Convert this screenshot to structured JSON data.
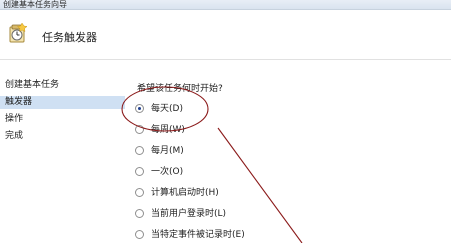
{
  "window": {
    "title": "创建基本任务向导"
  },
  "header": {
    "title": "任务触发器"
  },
  "sidebar": {
    "items": [
      {
        "label": "创建基本任务",
        "selected": false
      },
      {
        "label": "触发器",
        "selected": true
      },
      {
        "label": "操作",
        "selected": false
      },
      {
        "label": "完成",
        "selected": false
      }
    ]
  },
  "main": {
    "question": "希望该任务何时开始?",
    "options": [
      {
        "label": "每天(D)",
        "checked": true
      },
      {
        "label": "每周(W)",
        "checked": false
      },
      {
        "label": "每月(M)",
        "checked": false
      },
      {
        "label": "一次(O)",
        "checked": false
      },
      {
        "label": "计算机启动时(H)",
        "checked": false
      },
      {
        "label": "当前用户登录时(L)",
        "checked": false
      },
      {
        "label": "当特定事件被记录时(E)",
        "checked": false
      }
    ]
  },
  "annotation": {
    "color": "#8b1a1a"
  },
  "icons": {
    "header": "task-clock-icon",
    "radio": "radio-button"
  }
}
